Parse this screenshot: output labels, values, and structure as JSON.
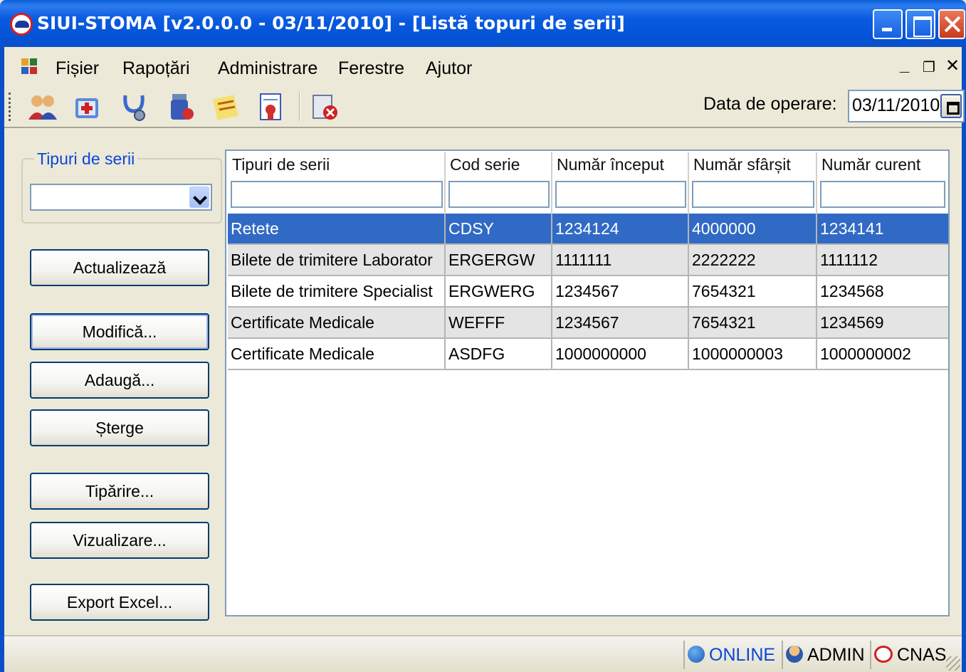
{
  "window": {
    "title": "SIUI-STOMA [v2.0.0.0 - 03/11/2010] - [Listă topuri de serii]"
  },
  "menu": {
    "items": [
      "Fișier",
      "Rapoțări",
      "Administrare",
      "Ferestre",
      "Ajutor"
    ]
  },
  "toolbar": {
    "icons": [
      "patients-icon",
      "medical-kit-icon",
      "stethoscope-icon",
      "medicine-bottle-icon",
      "notes-icon",
      "certificate-icon",
      "delete-doc-icon"
    ],
    "date_label": "Data de operare:",
    "date_value": "03/11/2010"
  },
  "left": {
    "group_label": "Tipuri de serii",
    "combo_value": "",
    "buttons": {
      "actualizeaza": "Actualizează",
      "modifica": "Modifică...",
      "adauga": "Adaugă...",
      "sterge": "Șterge",
      "tiparire": "Tipărire...",
      "vizualizare": "Vizualizare...",
      "export": "Export Excel..."
    }
  },
  "grid": {
    "columns": [
      "Tipuri de serii",
      "Cod serie",
      "Număr început",
      "Număr sfârșit",
      "Număr curent"
    ],
    "rows": [
      [
        "Retete",
        "CDSY",
        "1234124",
        "4000000",
        "1234141"
      ],
      [
        "Bilete de trimitere Laborator",
        "ERGERGW",
        "1111111",
        "2222222",
        "1111112"
      ],
      [
        "Bilete de trimitere Specialist",
        "ERGWERG",
        "1234567",
        "7654321",
        "1234568"
      ],
      [
        "Certificate Medicale",
        "WEFFF",
        "1234567",
        "7654321",
        "1234569"
      ],
      [
        "Certificate Medicale",
        "ASDFG",
        "1000000000",
        "1000000003",
        "1000000002"
      ]
    ],
    "selected_row": 0
  },
  "status": {
    "online": "ONLINE",
    "user": "ADMIN",
    "org": "CNAS"
  },
  "colors": {
    "titlebar": "#0a5ae0",
    "selection": "#316ac5",
    "online_text": "#0a46d8"
  }
}
